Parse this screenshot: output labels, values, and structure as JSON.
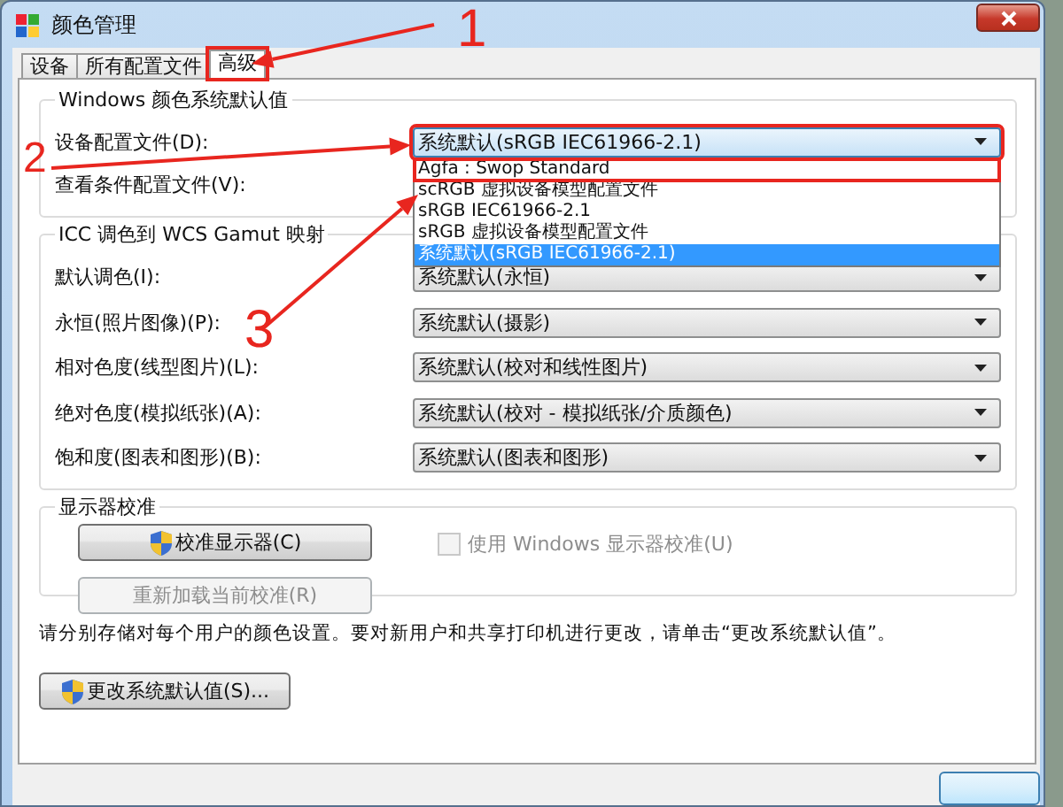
{
  "window": {
    "title": "颜色管理"
  },
  "tabs": [
    {
      "label": "设备",
      "selected": false,
      "highlighted": false
    },
    {
      "label": "所有配置文件",
      "selected": false,
      "highlighted": false
    },
    {
      "label": "高级",
      "selected": true,
      "highlighted": true
    }
  ],
  "defaults_group": {
    "title": "Windows 颜色系统默认值",
    "rows": [
      {
        "kind": "combo",
        "label": "设备配置文件(D):",
        "value": "系统默认(sRGB IEC61966-2.1)",
        "expanded": true,
        "highlighted": true,
        "options": [
          {
            "label": "Agfa : Swop Standard",
            "selected": false,
            "highlighted": true
          },
          {
            "label": "scRGB 虚拟设备模型配置文件",
            "selected": false,
            "highlighted": false
          },
          {
            "label": "sRGB IEC61966-2.1",
            "selected": false,
            "highlighted": false
          },
          {
            "label": "sRGB 虚拟设备模型配置文件",
            "selected": false,
            "highlighted": false
          },
          {
            "label": "系统默认(sRGB IEC61966-2.1)",
            "selected": true,
            "highlighted": false
          }
        ]
      },
      {
        "kind": "label",
        "label": "查看条件配置文件(V):"
      }
    ]
  },
  "icc_group": {
    "title": "ICC 调色到 WCS Gamut 映射",
    "rows": [
      {
        "label": "默认调色(I):",
        "value": "系统默认(永恒)"
      },
      {
        "label": "永恒(照片图像)(P):",
        "value": "系统默认(摄影)"
      },
      {
        "label": "相对色度(线型图片)(L):",
        "value": "系统默认(校对和线性图片)"
      },
      {
        "label": "绝对色度(模拟纸张)(A):",
        "value": "系统默认(校对 - 模拟纸张/介质颜色)"
      },
      {
        "label": "饱和度(图表和图形)(B):",
        "value": "系统默认(图表和图形)"
      }
    ]
  },
  "calibration_group": {
    "title": "显示器校准",
    "buttons": [
      {
        "label": "校准显示器(C)",
        "disabled": false,
        "shield": true
      },
      {
        "label": "重新加载当前校准(R)",
        "disabled": true,
        "shield": false
      }
    ],
    "checkbox": {
      "label": "使用 Windows 显示器校准(U)",
      "checked": false,
      "disabled": true
    }
  },
  "info_text": "请分别存储对每个用户的颜色设置。要对新用户和共享打印机进行更改，请单击“更改系统默认值”。",
  "change_defaults_button": {
    "label": "更改系统默认值(S)...",
    "shield": true
  },
  "annotations": [
    {
      "text": "1"
    },
    {
      "text": "2"
    },
    {
      "text": "3"
    }
  ]
}
